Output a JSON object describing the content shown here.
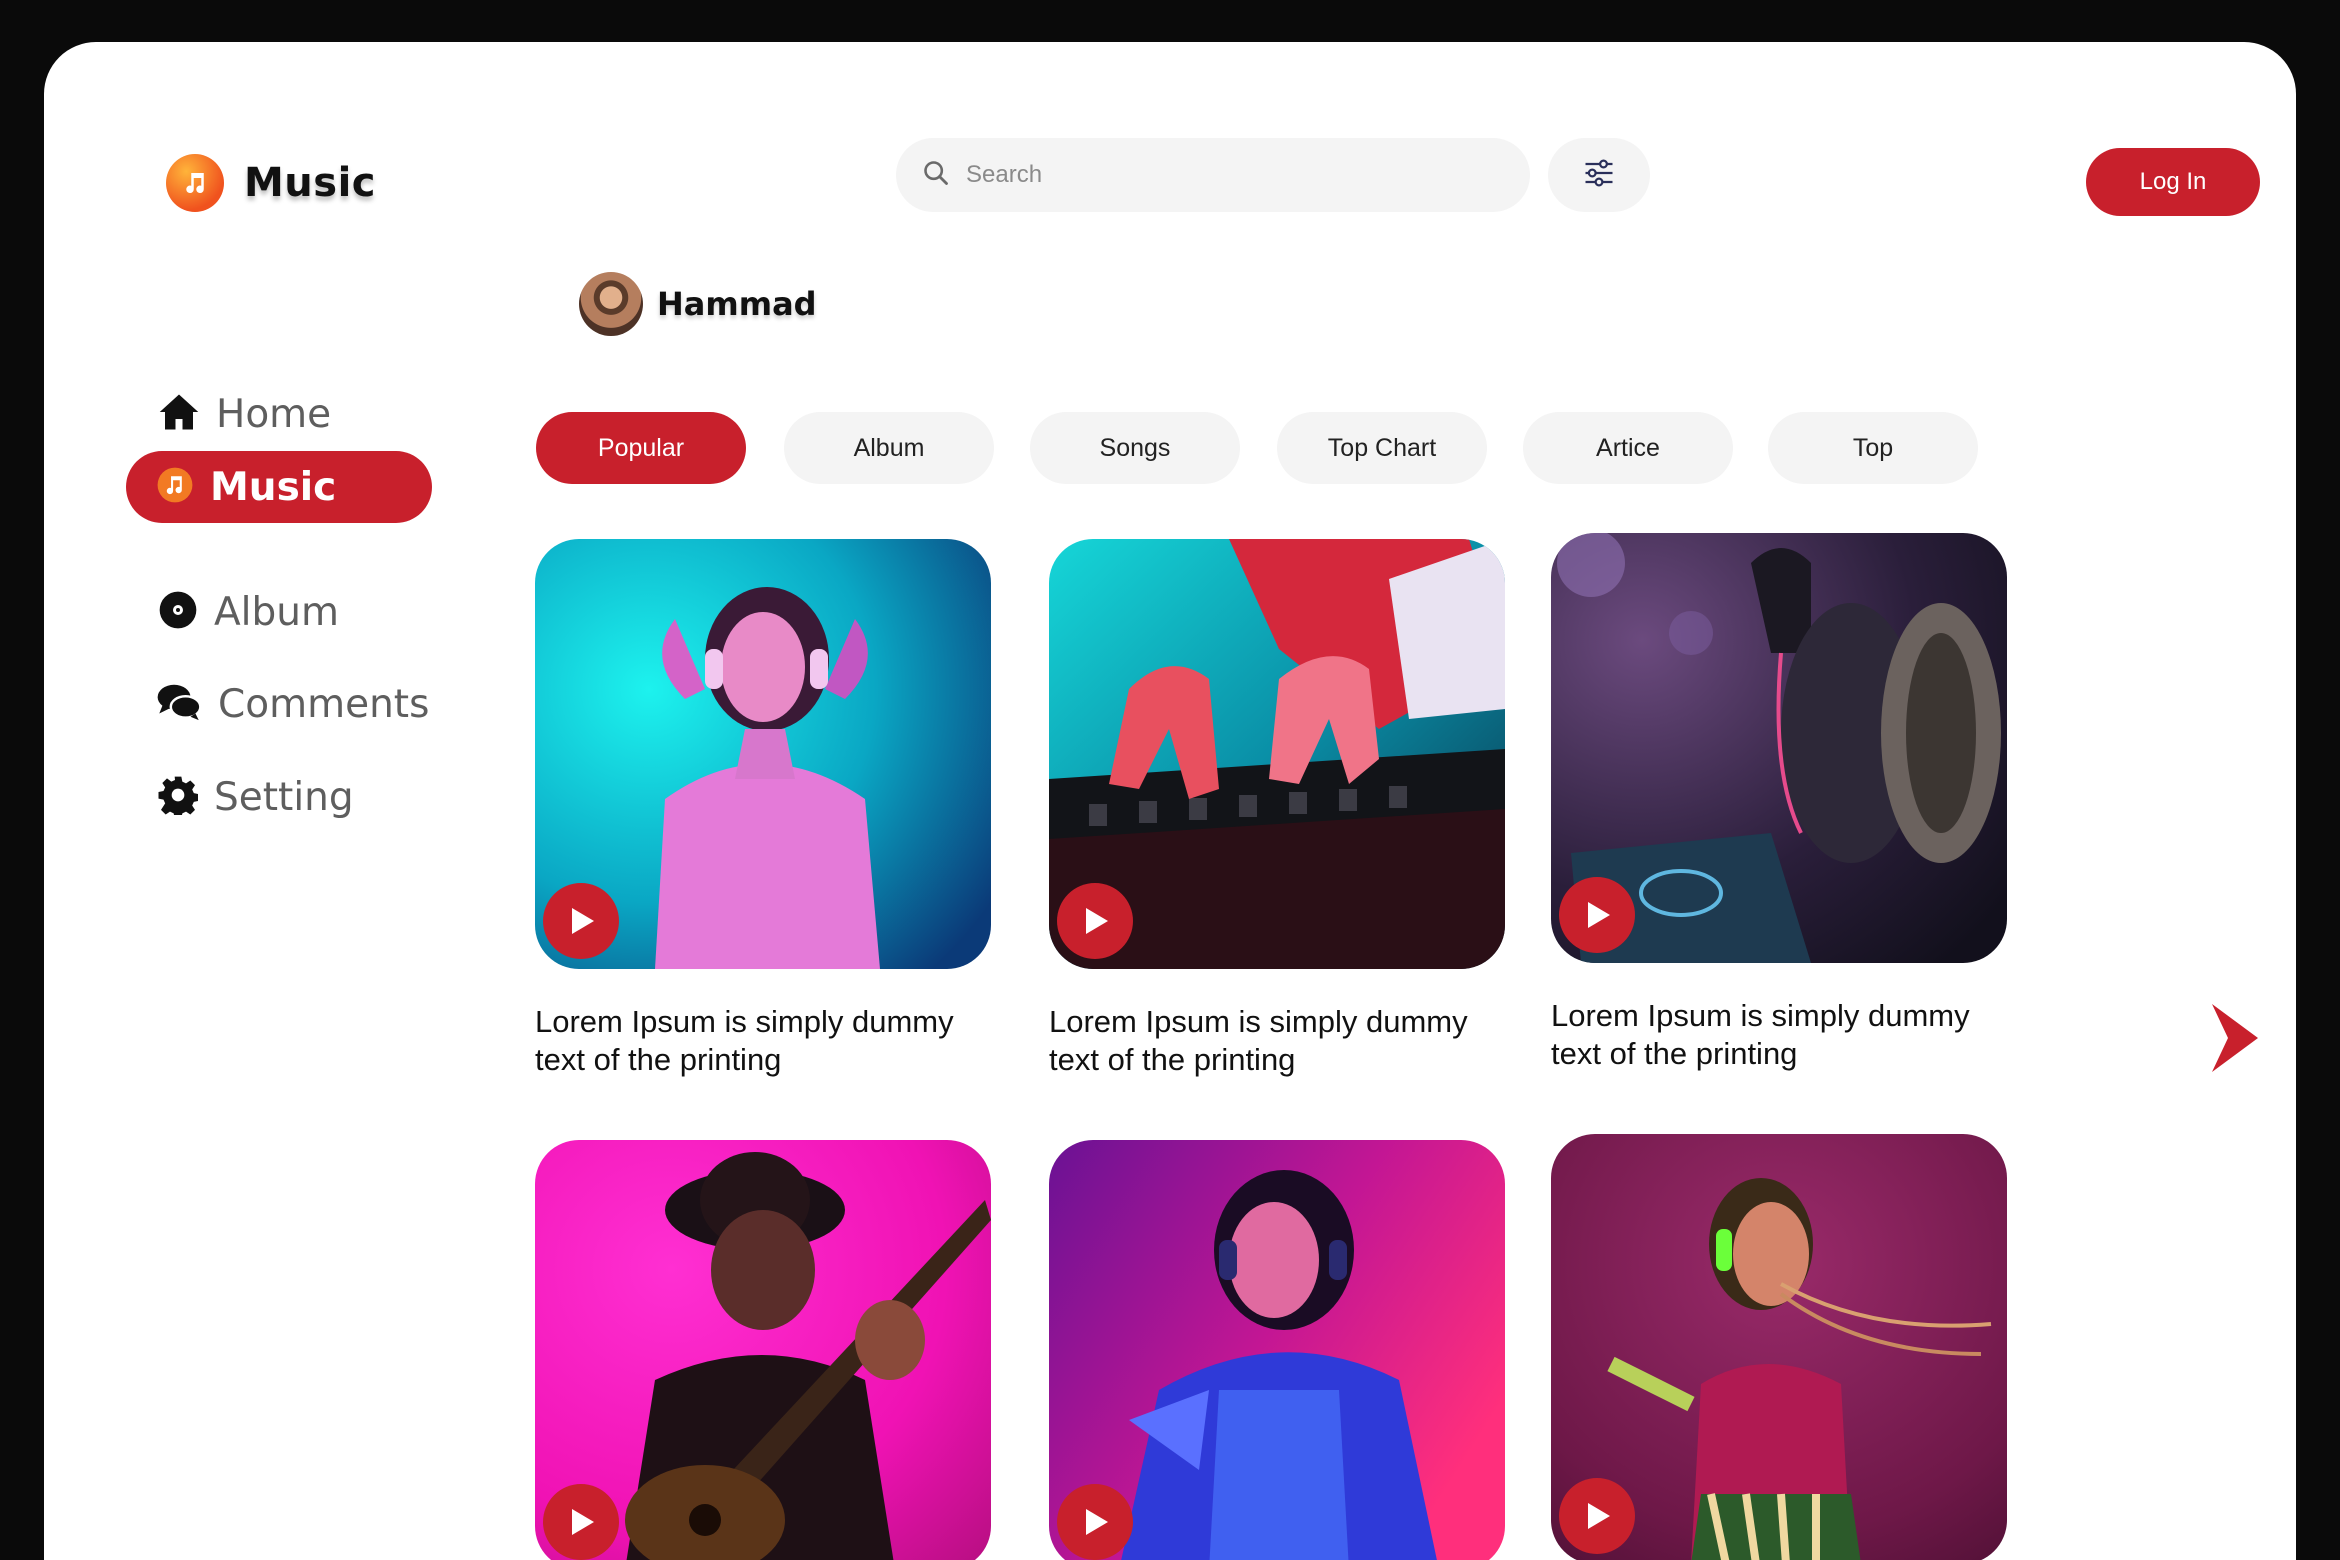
{
  "app": {
    "title": "Music"
  },
  "search": {
    "placeholder": "Search"
  },
  "header": {
    "login_label": "Log In"
  },
  "user": {
    "name": "Hammad"
  },
  "sidebar": {
    "items": [
      {
        "label": "Home",
        "icon": "home-icon"
      },
      {
        "label": "Music",
        "icon": "music-icon",
        "active": true
      },
      {
        "label": "Album",
        "icon": "album-icon"
      },
      {
        "label": "Comments",
        "icon": "comments-icon"
      },
      {
        "label": "Setting",
        "icon": "gear-icon"
      }
    ]
  },
  "tabs": [
    {
      "label": "Popular",
      "active": true
    },
    {
      "label": "Album"
    },
    {
      "label": "Songs"
    },
    {
      "label": "Top Chart"
    },
    {
      "label": "Artice"
    },
    {
      "label": "Top"
    }
  ],
  "cards": [
    {
      "caption": "Lorem Ipsum is simply dummy text of the printing"
    },
    {
      "caption": "Lorem Ipsum is simply dummy text of the printing"
    },
    {
      "caption": "Lorem Ipsum is simply dummy text of the printing"
    },
    {
      "caption": ""
    },
    {
      "caption": ""
    },
    {
      "caption": ""
    }
  ],
  "colors": {
    "accent": "#c8202c",
    "pill_bg": "#f4f4f4",
    "logo_orange": "#f0521e"
  }
}
